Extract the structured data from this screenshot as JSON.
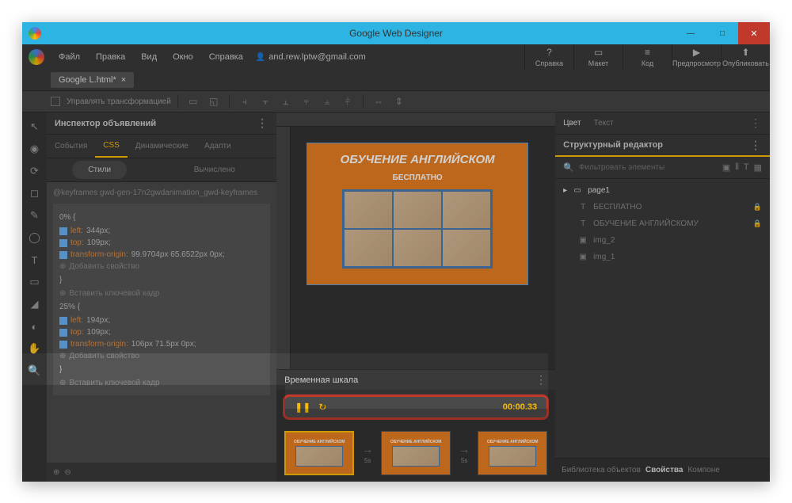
{
  "window": {
    "title": "Google Web Designer"
  },
  "menu": {
    "file": "Файл",
    "edit": "Правка",
    "view": "Вид",
    "window": "Окно",
    "help": "Справка",
    "user": "and.rew.lptw@gmail.com"
  },
  "topbtns": {
    "help": {
      "label": "Справка",
      "ico": "?"
    },
    "layout": {
      "label": "Макет",
      "ico": "▭"
    },
    "code": {
      "label": "Код",
      "ico": "≡"
    },
    "preview": {
      "label": "Предпросмотр",
      "ico": "▶"
    },
    "publish": {
      "label": "Опубликовать",
      "ico": "⬆"
    }
  },
  "filetab": {
    "name": "Google L.html*"
  },
  "toolbar": {
    "transform": "Управлять трансформацией"
  },
  "inspector": {
    "title": "Инспектор объявлений",
    "tabs": {
      "events": "События",
      "css": "CSS",
      "dynamic": "Динамические",
      "adaptive": "Адапти"
    },
    "sub": {
      "styles": "Стили",
      "computed": "Вычислено"
    },
    "rule": "@keyframes gwd-gen-17n2gwdanimation_gwd-keyframes",
    "kf0": "0% {",
    "kf25": "25% {",
    "p_left0": "344px;",
    "p_left25": "194px;",
    "p_top": "109px;",
    "p_to0": "99.9704px 65.6522px 0px;",
    "p_to25": "106px 71.5px 0px;",
    "left": "left:",
    "top": "top:",
    "transform_origin": "transform-origin:",
    "add_prop": "Добавить свойство",
    "brace": "}",
    "insert_kf": "Вставить ключевой кадр"
  },
  "banner": {
    "title": "ОБУЧЕНИЕ АНГЛИЙСКОМ",
    "sub": "БЕСПЛАТНО"
  },
  "timeline": {
    "title": "Временная шкала",
    "time": "00:00.33",
    "interval": "5s"
  },
  "right": {
    "color": "Цвет",
    "text": "Текст",
    "editor": "Структурный редактор",
    "filter_ph": "Фильтровать элементы",
    "page": "page1",
    "el1": "БЕСПЛАТНО",
    "el2": "ОБУЧЕНИЕ АНГЛИЙСКОМУ",
    "el3": "img_2",
    "el4": "img_1",
    "lib": "Библиотека объектов",
    "props": "Свойства",
    "comp": "Компоне"
  }
}
